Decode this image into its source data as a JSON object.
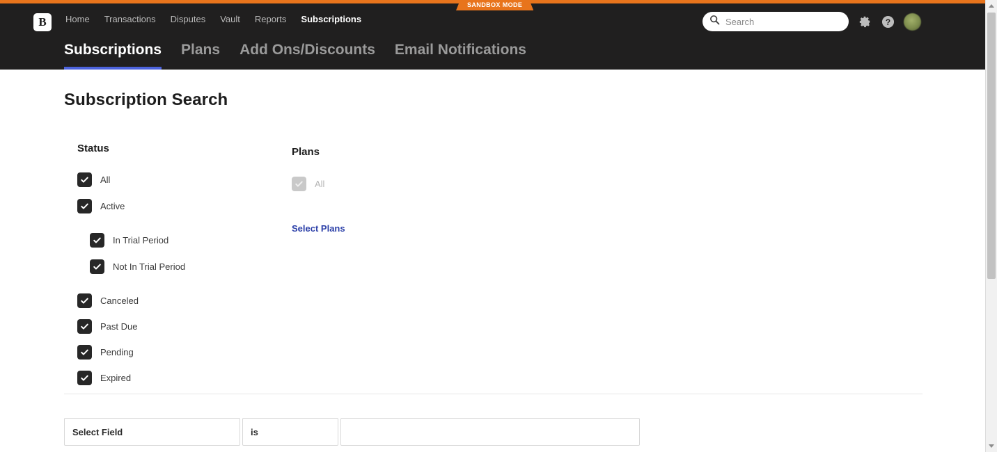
{
  "banner": {
    "sandbox_label": "SANDBOX MODE",
    "stripe_color": "#e8741c"
  },
  "header": {
    "logo_letter": "B",
    "nav": [
      {
        "label": "Home",
        "active": false
      },
      {
        "label": "Transactions",
        "active": false
      },
      {
        "label": "Disputes",
        "active": false
      },
      {
        "label": "Vault",
        "active": false
      },
      {
        "label": "Reports",
        "active": false
      },
      {
        "label": "Subscriptions",
        "active": true
      }
    ],
    "search": {
      "placeholder": "Search",
      "value": "",
      "icon": "search-icon"
    },
    "settings_icon": "gear-icon",
    "help_icon": "help-circle-icon",
    "avatar": "user-avatar",
    "accent_color": "#4c63dd",
    "background_color": "#201f1f"
  },
  "tabs": [
    {
      "label": "Subscriptions",
      "active": true
    },
    {
      "label": "Plans",
      "active": false
    },
    {
      "label": "Add Ons/Discounts",
      "active": false
    },
    {
      "label": "Email Notifications",
      "active": false
    }
  ],
  "main": {
    "title": "Subscription Search",
    "status": {
      "heading": "Status",
      "items": [
        {
          "label": "All",
          "checked": true,
          "indent": false,
          "disabled": false
        },
        {
          "label": "Active",
          "checked": true,
          "indent": false,
          "disabled": false
        },
        {
          "label": "In Trial Period",
          "checked": true,
          "indent": true,
          "disabled": false
        },
        {
          "label": "Not In Trial Period",
          "checked": true,
          "indent": true,
          "disabled": false
        },
        {
          "label": "Canceled",
          "checked": true,
          "indent": false,
          "disabled": false
        },
        {
          "label": "Past Due",
          "checked": true,
          "indent": false,
          "disabled": false
        },
        {
          "label": "Pending",
          "checked": true,
          "indent": false,
          "disabled": false
        },
        {
          "label": "Expired",
          "checked": true,
          "indent": false,
          "disabled": false
        }
      ]
    },
    "plans": {
      "heading": "Plans",
      "all_label": "All",
      "all_checked": true,
      "all_disabled": true,
      "select_link": "Select Plans",
      "link_color": "#2b3fa8"
    },
    "filter_row": {
      "field_label": "Select Field",
      "operator_label": "is",
      "value": "",
      "value_placeholder": ""
    }
  }
}
